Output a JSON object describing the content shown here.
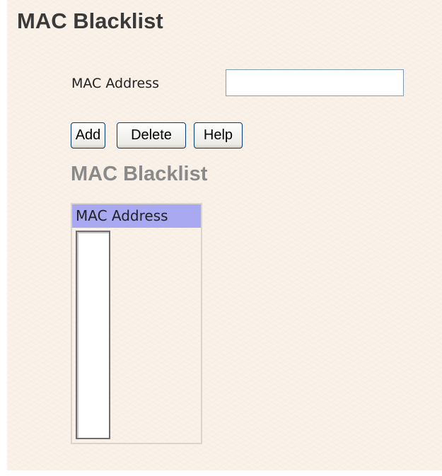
{
  "header": {
    "title": "MAC Blacklist"
  },
  "form": {
    "mac_label": "MAC Address",
    "mac_value": ""
  },
  "buttons": {
    "add": "Add",
    "delete": "Delete",
    "help": "Help"
  },
  "list_section": {
    "title": "MAC Blacklist",
    "column_header": "MAC Address",
    "rows": []
  },
  "colors": {
    "background": "#faf2e9",
    "title_text": "#3a3a3a",
    "subtitle_text": "#8a8a8a",
    "table_header_bg": "#a9a9f2"
  }
}
